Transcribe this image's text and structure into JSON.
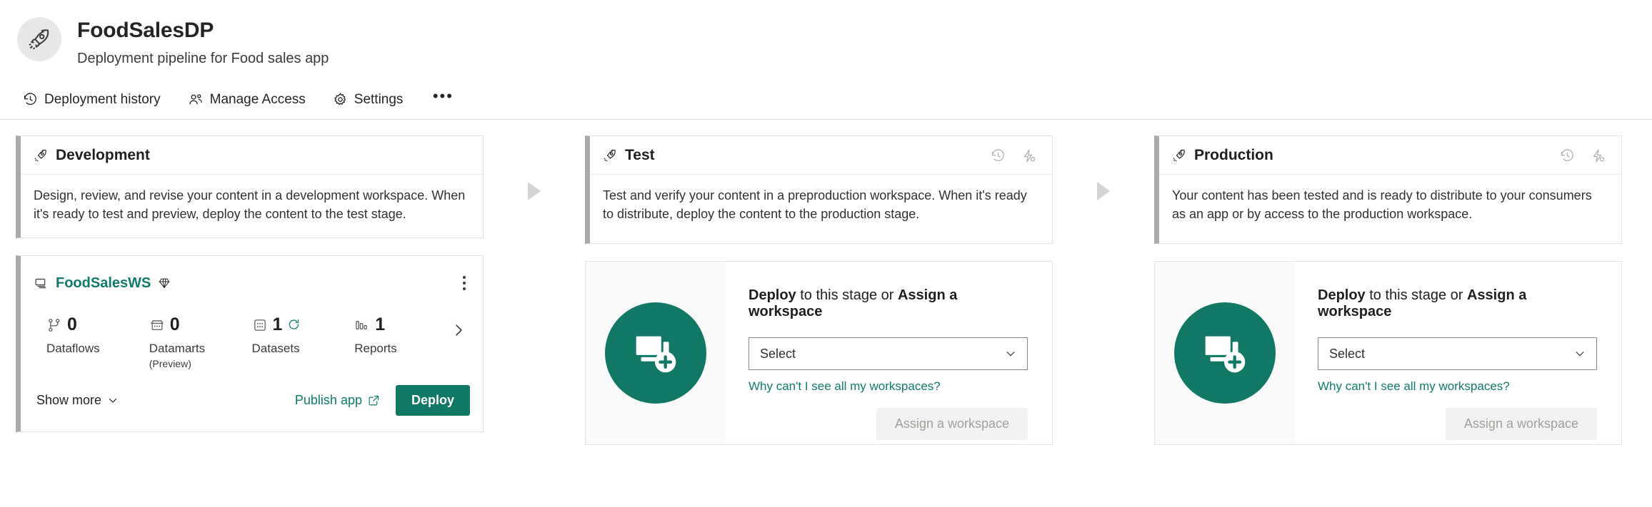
{
  "header": {
    "avatar_icon": "rocket-icon",
    "title": "FoodSalesDP",
    "subtitle": "Deployment pipeline for Food sales app"
  },
  "command_bar": {
    "items": [
      {
        "label": "Deployment history",
        "icon": "history-icon"
      },
      {
        "label": "Manage Access",
        "icon": "people-icon"
      },
      {
        "label": "Settings",
        "icon": "gear-icon"
      }
    ],
    "overflow_label": "•••"
  },
  "stages": [
    {
      "name": "Development",
      "icon": "rocket-icon",
      "description": "Design, review, and revise your content in a development workspace. When it's ready to test and preview, deploy the content to the test stage.",
      "head_actions": []
    },
    {
      "name": "Test",
      "icon": "rocket-icon",
      "description": "Test and verify your content in a preproduction workspace. When it's ready to distribute, deploy the content to the production stage.",
      "head_actions": [
        {
          "icon": "history-icon"
        },
        {
          "icon": "deployment-rules-icon"
        }
      ]
    },
    {
      "name": "Production",
      "icon": "rocket-icon",
      "description": "Your content has been tested and is ready to distribute to your consumers as an app or by access to the production workspace.",
      "head_actions": [
        {
          "icon": "history-icon"
        },
        {
          "icon": "deployment-rules-icon"
        }
      ]
    }
  ],
  "workspace_card": {
    "workspace_icon": "workspace-stack-icon",
    "name": "FoodSalesWS",
    "premium_icon": "diamond-icon",
    "kebab_label": "More options",
    "metrics": [
      {
        "icon": "dataflow-icon",
        "count": "0",
        "label": "Dataflows",
        "sublabel": ""
      },
      {
        "icon": "datamart-icon",
        "count": "0",
        "label": "Datamarts",
        "sublabel": "(Preview)"
      },
      {
        "icon": "dataset-icon",
        "count": "1",
        "label": "Datasets",
        "sublabel": "",
        "refresh_icon": "refresh-icon"
      },
      {
        "icon": "report-icon",
        "count": "1",
        "label": "Reports",
        "sublabel": ""
      }
    ],
    "scroll_next_icon": "chevron-right-icon",
    "show_more_label": "Show more",
    "show_more_icon": "chevron-down-icon",
    "publish_app_label": "Publish app",
    "publish_app_icon": "external-link-icon",
    "deploy_label": "Deploy"
  },
  "empty_stage": {
    "illustration_icon": "add-workspace-icon",
    "title_prefix": "Deploy",
    "title_middle": " to this stage or ",
    "title_suffix": "Assign a workspace",
    "select_value": "Select",
    "select_icon": "chevron-down-icon",
    "help_link": "Why can't I see all my workspaces?",
    "assign_button": "Assign a workspace"
  },
  "colors": {
    "teal": "#117865",
    "teal_text": "#0f7b6c",
    "stage_accent": "#ACA9A6",
    "arrow": "#d6d4d2",
    "disabled_text": "#a19f9d"
  }
}
